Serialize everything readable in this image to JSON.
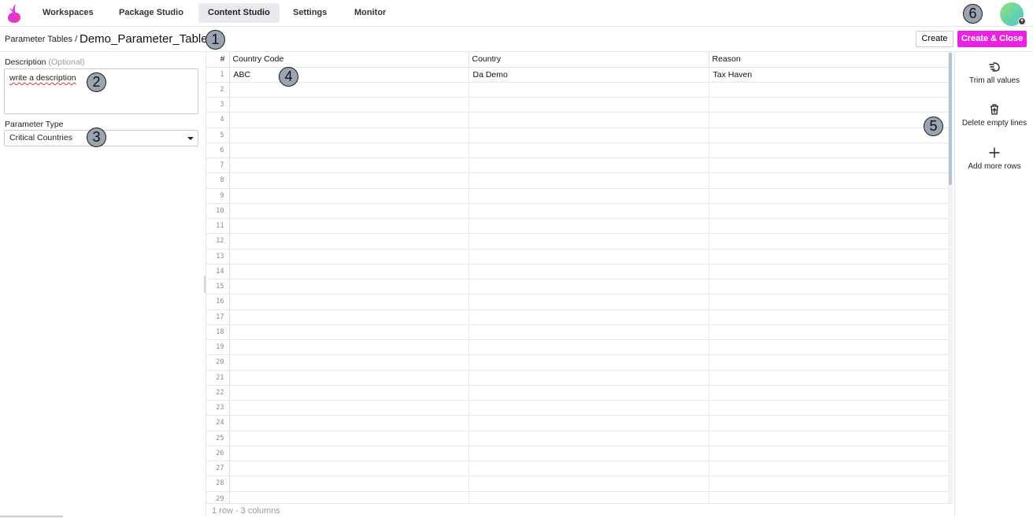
{
  "nav": {
    "items": [
      {
        "label": "Workspaces"
      },
      {
        "label": "Package Studio"
      },
      {
        "label": "Content Studio"
      },
      {
        "label": "Settings"
      },
      {
        "label": "Monitor"
      }
    ],
    "active": "Content Studio"
  },
  "markers": [
    "1",
    "2",
    "3",
    "4",
    "5",
    "6"
  ],
  "header": {
    "breadcrumb": "Parameter Tables /",
    "title": "Demo_Parameter_Table",
    "create_label": "Create",
    "create_close_label": "Create & Close"
  },
  "form": {
    "description_label": "Description",
    "description_optional": "(Optional)",
    "description_value": "write a description",
    "type_label": "Parameter Type",
    "type_value": "Critical Countries"
  },
  "table": {
    "columns": [
      "#",
      "Country Code",
      "Country",
      "Reason"
    ],
    "rows": [
      [
        "ABC",
        "Da Demo",
        "Tax Haven"
      ]
    ],
    "row_count_visible": 29,
    "footer": "1 row - 3 columns"
  },
  "actions": [
    {
      "label": "Trim all values",
      "icon": "trim-hand-icon"
    },
    {
      "label": "Delete empty lines",
      "icon": "trash-upload-icon"
    },
    {
      "label": "Add more rows",
      "icon": "plus-icon"
    }
  ],
  "colors": {
    "accent": "#e824e0",
    "marker": "#9aa5b1",
    "active_nav": "#e8eaee"
  }
}
